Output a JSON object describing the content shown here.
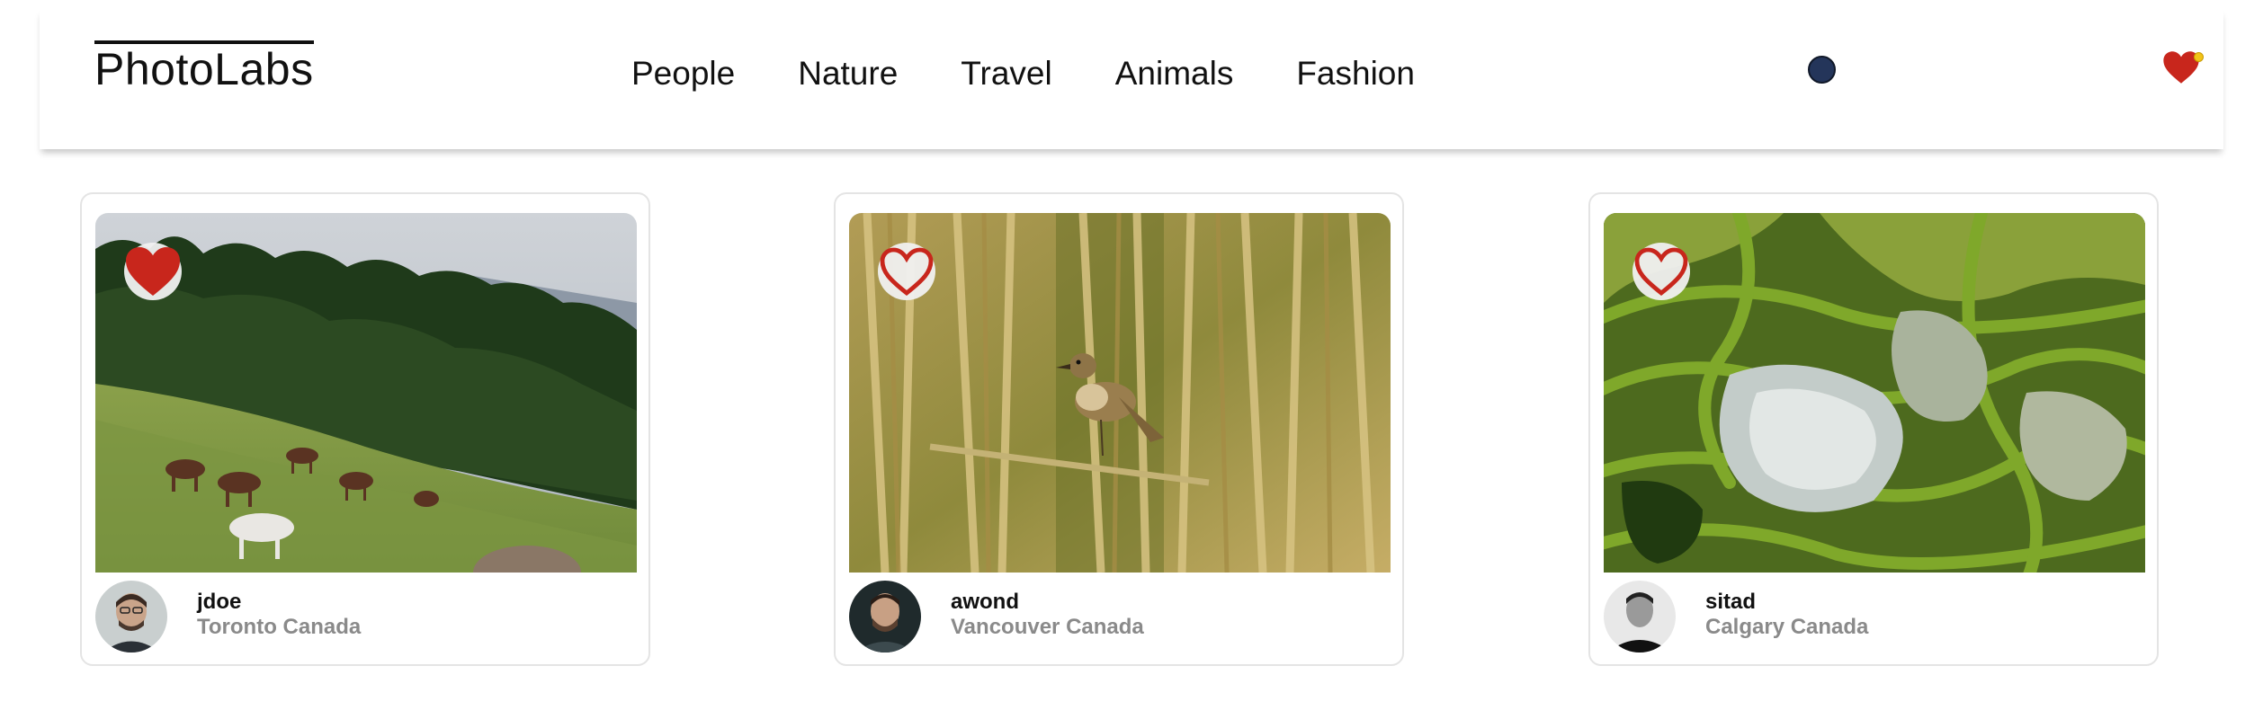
{
  "nav": {
    "brand": "PhotoLabs",
    "topics": [
      "People",
      "Nature",
      "Travel",
      "Animals",
      "Fashion"
    ],
    "colors": {
      "fav_heart": "#c8261c",
      "notification_dot": "#f2c318",
      "topic_dot": "#24355a"
    }
  },
  "photos": [
    {
      "username": "jdoe",
      "location": "Toronto Canada",
      "liked": true,
      "scene": "horses-grazing-hillside"
    },
    {
      "username": "awond",
      "location": "Vancouver Canada",
      "liked": false,
      "scene": "bird-in-reeds"
    },
    {
      "username": "sitad",
      "location": "Calgary Canada",
      "liked": false,
      "scene": "rice-terraces"
    }
  ]
}
